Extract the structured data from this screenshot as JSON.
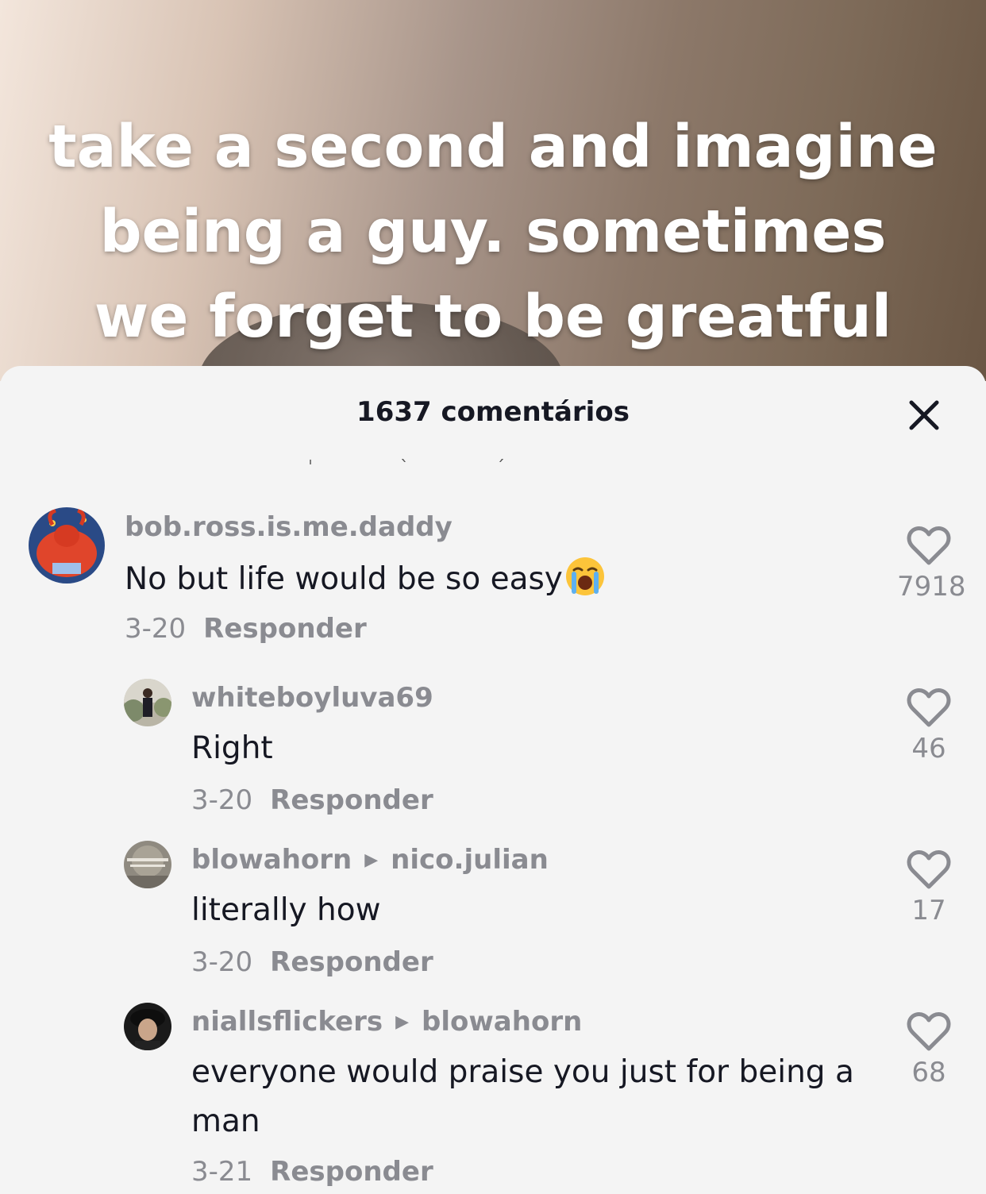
{
  "video": {
    "caption": "take a second and imagine being a guy. sometimes we forget to be greatful"
  },
  "comments_panel": {
    "title": "1637 comentários",
    "close_icon": "close-icon",
    "reply_label": "Responder",
    "comments": [
      {
        "username": "bob.ross.is.me.daddy",
        "text": "No but life would be so easy",
        "emoji": "loudly-crying-face",
        "date": "3-20",
        "likes": "7918"
      },
      {
        "username": "whiteboyluva69",
        "text": "Right",
        "date": "3-20",
        "likes": "46"
      },
      {
        "username": "blowahorn",
        "reply_to": "nico.julian",
        "text": "literally how",
        "date": "3-20",
        "likes": "17"
      },
      {
        "username": "niallsflickers",
        "reply_to": "blowahorn",
        "text": "everyone would praise you just for being a man",
        "date": "3-21",
        "likes": "68"
      }
    ]
  },
  "colors": {
    "sheet_bg": "#f4f4f4",
    "primary_text": "#161823",
    "secondary_text": "#8a8b91"
  }
}
